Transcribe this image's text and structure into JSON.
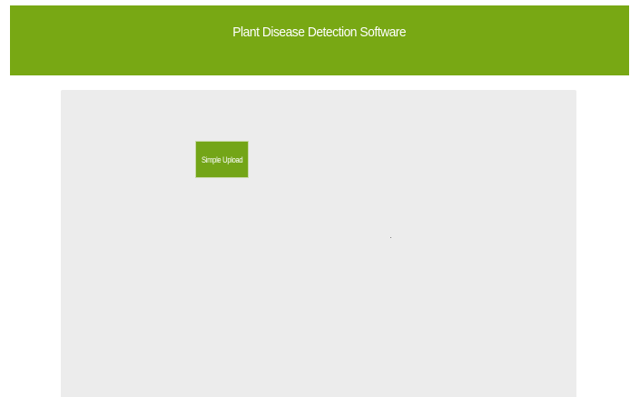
{
  "header": {
    "title": "Plant Disease Detection Software",
    "background_color": "#78a814"
  },
  "main": {
    "panel_color": "#ececec",
    "upload_button": {
      "label": "Simple Upload",
      "color": "#73a517"
    }
  }
}
